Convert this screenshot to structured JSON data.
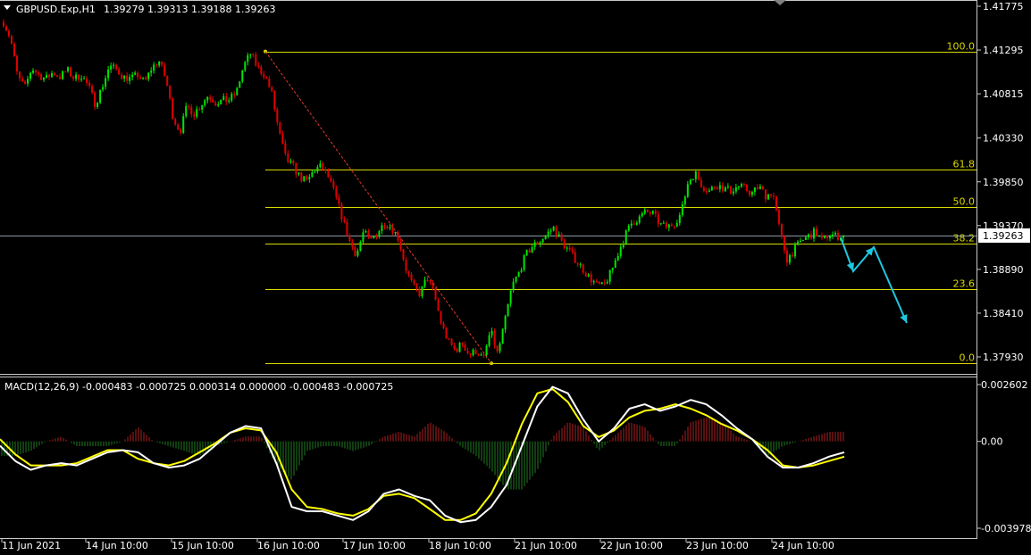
{
  "chart_data": [
    {
      "type": "candlestick",
      "symbol_label": "GBPUSD.Exp,H1",
      "ohlc_label": "1.39279 1.39313 1.39188 1.39263",
      "ylim": [
        1.3775,
        1.4177
      ],
      "price_ticks": [
        "1.41775",
        "1.41295",
        "1.40815",
        "1.40330",
        "1.39850",
        "1.39370",
        "1.38890",
        "1.38410",
        "1.37930"
      ],
      "current_price": "1.39263",
      "time_labels": [
        "11 Jun 2021",
        "14 Jun 10:00",
        "15 Jun 10:00",
        "16 Jun 10:00",
        "17 Jun 10:00",
        "18 Jun 10:00",
        "21 Jun 10:00",
        "22 Jun 10:00",
        "23 Jun 10:00",
        "24 Jun 10:00"
      ],
      "fibonacci": {
        "high": 1.4128,
        "low": 1.3786,
        "levels": [
          {
            "label": "100.0",
            "price": 1.4128
          },
          {
            "label": "61.8",
            "price": 1.3998
          },
          {
            "label": "50.0",
            "price": 1.3957
          },
          {
            "label": "38.2",
            "price": 1.3917
          },
          {
            "label": "23.6",
            "price": 1.3867
          },
          {
            "label": "0.0",
            "price": 1.3786
          }
        ]
      },
      "bars": [
        1.416,
        1.4142,
        1.41,
        1.4088,
        1.411,
        1.4102,
        1.4098,
        1.4105,
        1.41,
        1.4108,
        1.4098,
        1.4102,
        1.409,
        1.407,
        1.409,
        1.4112,
        1.4108,
        1.41,
        1.4098,
        1.4102,
        1.4094,
        1.411,
        1.4118,
        1.4098,
        1.4056,
        1.404,
        1.4068,
        1.406,
        1.407,
        1.408,
        1.4072,
        1.4074,
        1.4075,
        1.4083,
        1.4112,
        1.4126,
        1.411,
        1.4102,
        1.4082,
        1.404,
        1.401,
        1.4002,
        1.399,
        1.3985,
        1.3998,
        1.4002,
        1.399,
        1.397,
        1.3945,
        1.392,
        1.3905,
        1.393,
        1.392,
        1.393,
        1.394,
        1.3935,
        1.3922,
        1.389,
        1.387,
        1.3862,
        1.388,
        1.3862,
        1.383,
        1.381,
        1.38,
        1.3808,
        1.3795,
        1.38,
        1.379,
        1.3822,
        1.3796,
        1.383,
        1.387,
        1.3885,
        1.3905,
        1.3915,
        1.392,
        1.3928,
        1.3935,
        1.392,
        1.391,
        1.39,
        1.389,
        1.388,
        1.3872,
        1.387,
        1.3885,
        1.3905,
        1.3925,
        1.394,
        1.3945,
        1.3952,
        1.395,
        1.3938,
        1.3935,
        1.394,
        1.395,
        1.3985,
        1.3995,
        1.398,
        1.3975,
        1.3982,
        1.3978,
        1.3975,
        1.398,
        1.3978,
        1.3972,
        1.398,
        1.397,
        1.3974,
        1.393,
        1.39,
        1.391,
        1.392,
        1.3925,
        1.393,
        1.392,
        1.3928,
        1.3925,
        1.3926
      ],
      "projection": [
        [
          941,
          266
        ],
        [
          955,
          304
        ],
        [
          978,
          277
        ],
        [
          1015,
          362
        ]
      ]
    },
    {
      "type": "line",
      "indicator_label": "MACD(12,26,9) -0.000483 -0.000725 0.000314 0.000000 -0.000483 -0.000725",
      "ylim": [
        -0.003978,
        0.002602
      ],
      "ticks": [
        "0.002602",
        "0.00",
        "-0.003978"
      ],
      "series": [
        {
          "color": "#ffffff",
          "values": [
            -0.0002,
            -0.0009,
            -0.0013,
            -0.0011,
            -0.001,
            -0.0011,
            -0.0008,
            -0.0005,
            -0.0004,
            -0.0005,
            -0.001,
            -0.0012,
            -0.0011,
            -0.0008,
            -0.0002,
            0.0004,
            0.0007,
            0.0006,
            -0.001,
            -0.003,
            -0.0032,
            -0.0032,
            -0.0034,
            -0.0036,
            -0.0032,
            -0.0024,
            -0.0022,
            -0.0025,
            -0.0027,
            -0.0034,
            -0.0037,
            -0.0036,
            -0.003,
            -0.002,
            -0.0002,
            0.0016,
            0.0025,
            0.0022,
            0.001,
            0.0,
            0.0006,
            0.0015,
            0.0017,
            0.0014,
            0.0016,
            0.0019,
            0.0017,
            0.0012,
            0.0006,
            0.0001,
            -0.0007,
            -0.0012,
            -0.0012,
            -0.001,
            -0.0007,
            -0.0005
          ]
        },
        {
          "color": "#ffff00",
          "values": [
            0.0001,
            -0.0006,
            -0.0011,
            -0.0011,
            -0.0011,
            -0.001,
            -0.0007,
            -0.0004,
            -0.0004,
            -0.0008,
            -0.001,
            -0.0011,
            -0.0009,
            -0.0005,
            -0.0001,
            0.0004,
            0.0006,
            0.0005,
            -0.0005,
            -0.0022,
            -0.003,
            -0.0031,
            -0.0033,
            -0.0034,
            -0.0031,
            -0.0025,
            -0.0024,
            -0.0026,
            -0.0031,
            -0.0036,
            -0.0036,
            -0.0033,
            -0.0024,
            -0.001,
            0.0008,
            0.0022,
            0.0024,
            0.0018,
            0.0007,
            0.0002,
            0.0005,
            0.0011,
            0.0014,
            0.0015,
            0.0017,
            0.0015,
            0.0012,
            0.0008,
            0.0005,
            0.0001,
            -0.0004,
            -0.0011,
            -0.0012,
            -0.0011,
            -0.0009,
            -0.0007
          ]
        }
      ]
    }
  ]
}
